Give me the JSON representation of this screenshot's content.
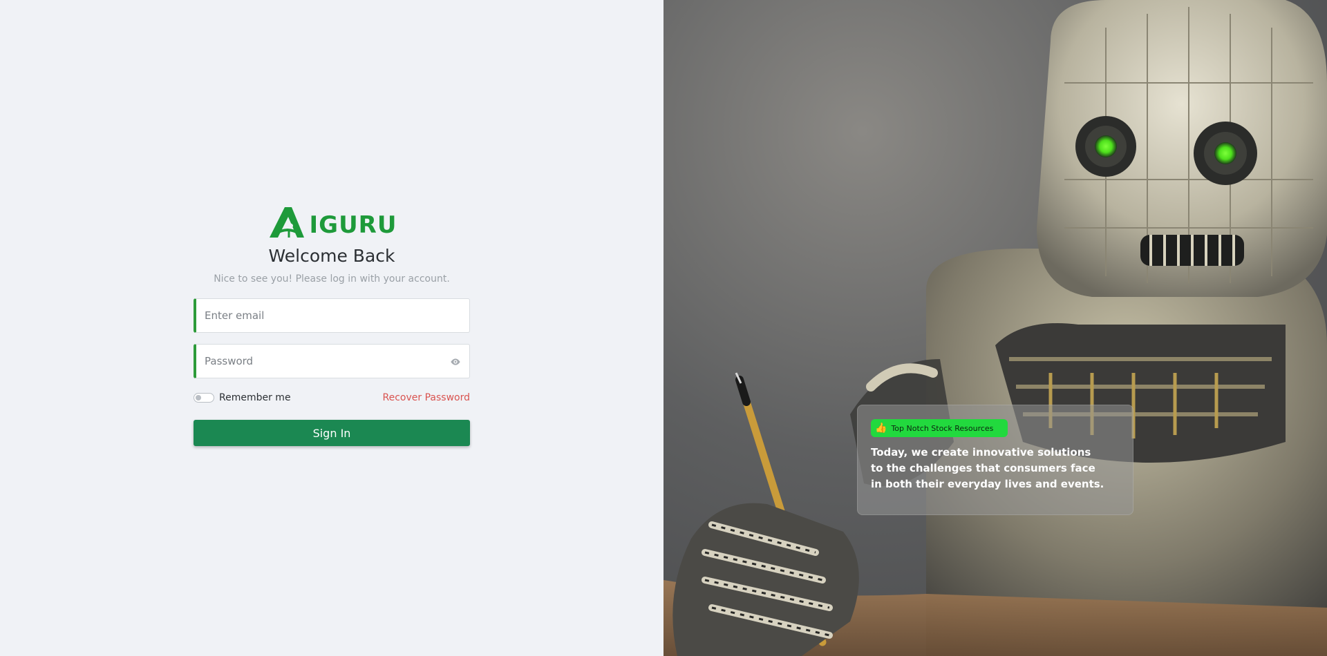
{
  "brand": {
    "logo_text": "IGURU",
    "logo_letter": "A",
    "color": "#1e9a3a"
  },
  "login": {
    "title": "Welcome Back",
    "subtitle": "Nice to see you! Please log in with your account.",
    "email_placeholder": "Enter email",
    "password_placeholder": "Password",
    "remember_label": "Remember me",
    "recover_label": "Recover Password",
    "signin_label": "Sign In"
  },
  "hero": {
    "badge_icon": "👍",
    "badge_text": "Top Notch Stock Resources",
    "description": "Today, we create innovative solutions to the challenges that consumers face in both their everyday lives and events."
  },
  "colors": {
    "accent": "#2d9b3a",
    "button": "#1b8852",
    "link": "#d9534f",
    "badge": "#22d93e",
    "background": "#f0f2f6"
  },
  "icons": {
    "password_toggle": "eye-icon",
    "badge": "thumbs-up-icon"
  }
}
